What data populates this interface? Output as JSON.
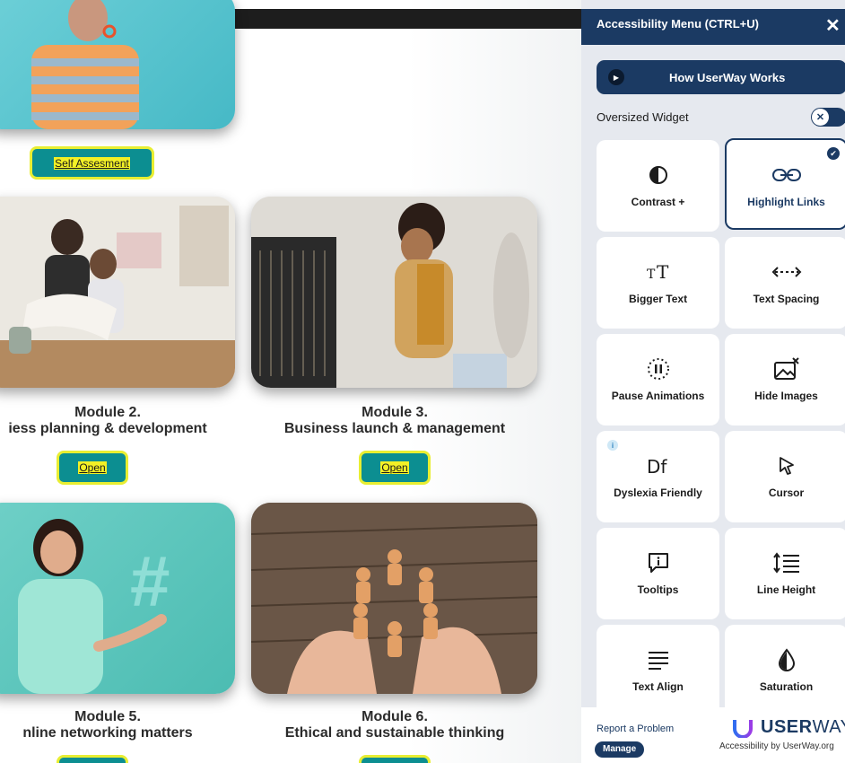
{
  "page": {
    "self_assessment_label": "Self Assesment",
    "modules": [
      {
        "title_line1": "Module 2.",
        "title_line2": "iess planning & development",
        "button": "Open"
      },
      {
        "title_line1": "Module 3.",
        "title_line2": "Business launch & management",
        "button": "Open"
      },
      {
        "title_line1": "Module 5.",
        "title_line2": "nline networking matters"
      },
      {
        "title_line1": "Module 6.",
        "title_line2": "Ethical and sustainable thinking"
      }
    ]
  },
  "panel": {
    "title": "Accessibility Menu (CTRL+U)",
    "close_icon": "✕",
    "how_button": "How UserWay Works",
    "oversized_label": "Oversized Widget",
    "tiles": [
      {
        "label": "Contrast +",
        "icon": "contrast-icon"
      },
      {
        "label": "Highlight Links",
        "icon": "link-icon",
        "active": true
      },
      {
        "label": "Bigger Text",
        "icon": "bigger-text-icon"
      },
      {
        "label": "Text Spacing",
        "icon": "text-spacing-icon"
      },
      {
        "label": "Pause Animations",
        "icon": "pause-animations-icon"
      },
      {
        "label": "Hide Images",
        "icon": "hide-images-icon"
      },
      {
        "label": "Dyslexia Friendly",
        "icon": "dyslexia-icon"
      },
      {
        "label": "Cursor",
        "icon": "cursor-icon"
      },
      {
        "label": "Tooltips",
        "icon": "tooltip-icon"
      },
      {
        "label": "Line Height",
        "icon": "line-height-icon"
      },
      {
        "label": "Text Align",
        "icon": "text-align-icon"
      },
      {
        "label": "Saturation",
        "icon": "saturation-icon"
      }
    ],
    "footer": {
      "report": "Report a Problem",
      "manage": "Manage",
      "brand_bold": "USER",
      "brand_light": "WAY",
      "brand_sub": "Accessibility by UserWay.org"
    }
  },
  "colors": {
    "panel_navy": "#1b3a63",
    "page_button_teal": "#0c8e91",
    "page_button_border": "#e8ee32",
    "page_button_highlight": "#f3f026"
  }
}
